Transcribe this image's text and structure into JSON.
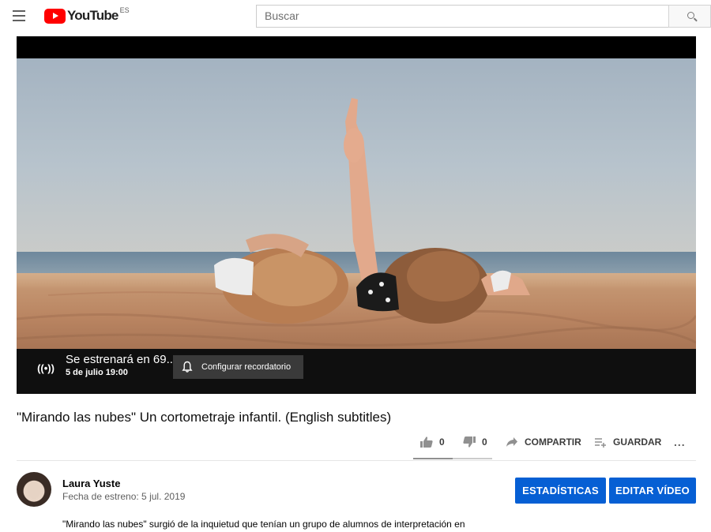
{
  "header": {
    "logo_text": "YouTube",
    "region_code": "ES",
    "search_placeholder": "Buscar"
  },
  "player": {
    "premiere_title": "Se estrenará en 69...",
    "premiere_date": "5 de julio 19:00",
    "reminder_label": "Configurar recordatorio"
  },
  "video": {
    "title": "\"Mirando las nubes\" Un cortometraje infantil. (English subtitles)",
    "likes": "0",
    "dislikes": "0",
    "like_ratio": 0.5,
    "share_label": "COMPARTIR",
    "save_label": "GUARDAR",
    "more_label": "..."
  },
  "channel": {
    "name": "Laura Yuste",
    "premiere_meta": "Fecha de estreno: 5 jul. 2019",
    "stats_button": "ESTADÍSTICAS",
    "edit_button": "EDITAR VÍDEO"
  },
  "description": {
    "first_line": "\"Mirando las nubes\" surgió de la inquietud que tenían un grupo de alumnos de interpretación en"
  },
  "colors": {
    "brand_red": "#ff0000",
    "action_blue": "#065fd4"
  }
}
